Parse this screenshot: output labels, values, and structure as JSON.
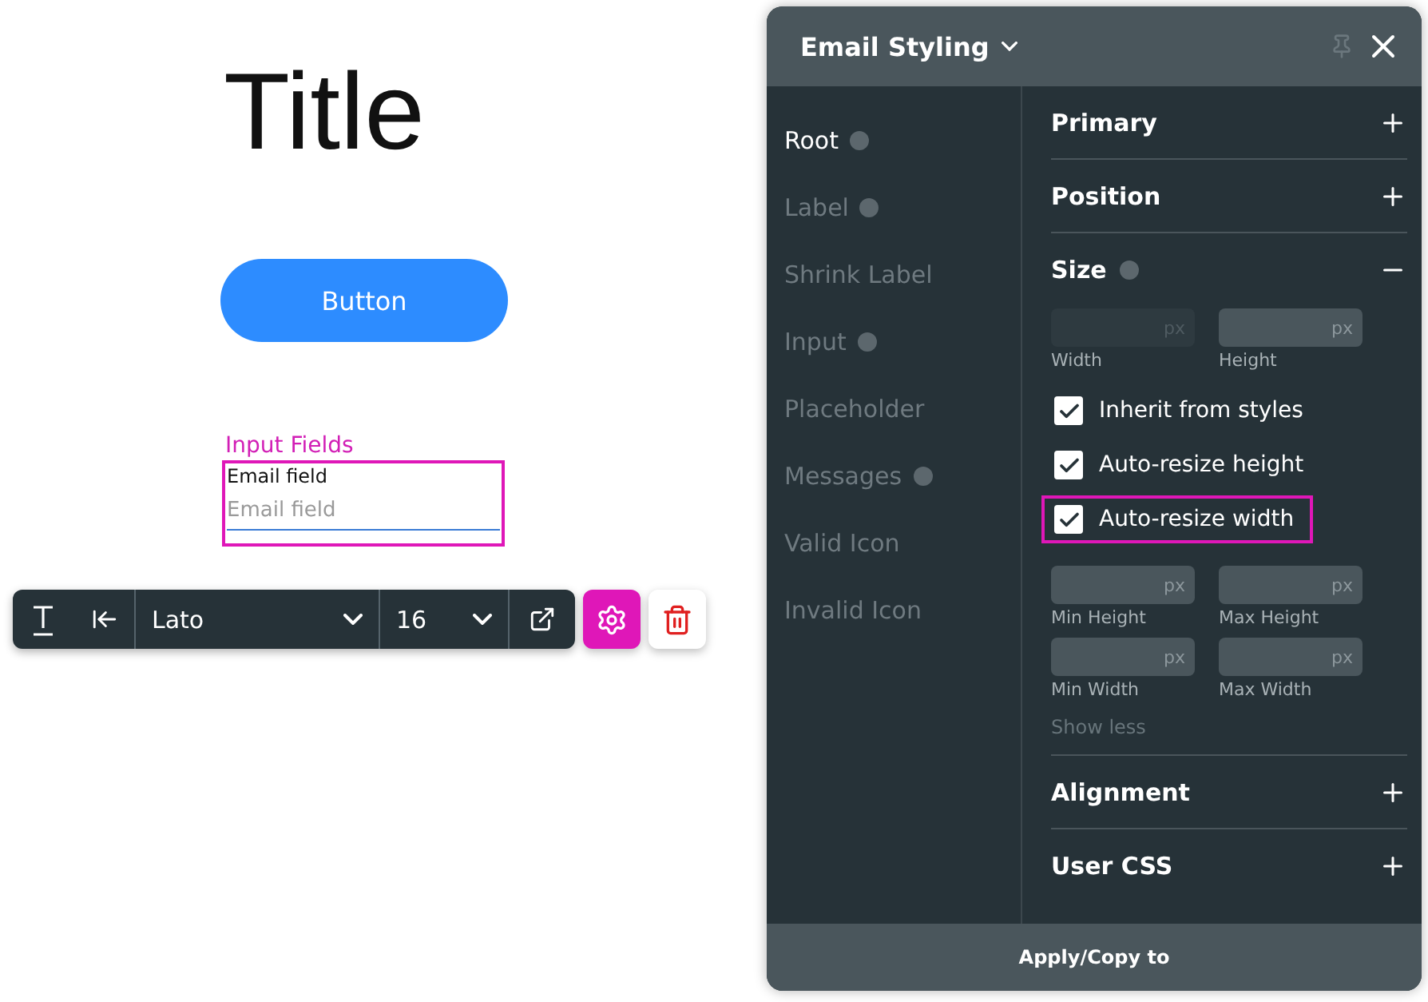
{
  "canvas": {
    "title": "Title",
    "button": "Button",
    "input_group": {
      "label": "Input Fields",
      "field_label": "Email field",
      "placeholder": "Email field",
      "highlighted": true
    }
  },
  "toolbar": {
    "font": "Lato",
    "size": "16"
  },
  "panel": {
    "title": "Email Styling",
    "parts": [
      {
        "label": "Root",
        "info": true,
        "selected": true
      },
      {
        "label": "Label",
        "info": true,
        "selected": false
      },
      {
        "label": "Shrink Label",
        "info": false,
        "selected": false
      },
      {
        "label": "Input",
        "info": true,
        "selected": false
      },
      {
        "label": "Placeholder",
        "info": false,
        "selected": false
      },
      {
        "label": "Messages",
        "info": true,
        "selected": false
      },
      {
        "label": "Valid Icon",
        "info": false,
        "selected": false
      },
      {
        "label": "Invalid Icon",
        "info": false,
        "selected": false
      }
    ],
    "sections": [
      {
        "label": "Primary",
        "info": false,
        "expanded": false
      },
      {
        "label": "Position",
        "info": false,
        "expanded": false
      },
      {
        "label": "Size",
        "info": true,
        "expanded": true
      },
      {
        "label": "Alignment",
        "info": false,
        "expanded": false
      },
      {
        "label": "User CSS",
        "info": false,
        "expanded": false
      }
    ],
    "size_fields": [
      {
        "label": "Width",
        "unit": "px",
        "disabled": true
      },
      {
        "label": "Height",
        "unit": "px",
        "disabled": false
      }
    ],
    "checkboxes": [
      {
        "label": "Inherit from styles",
        "checked": true,
        "highlighted": false
      },
      {
        "label": "Auto-resize height",
        "checked": true,
        "highlighted": false
      },
      {
        "label": "Auto-resize width",
        "checked": true,
        "highlighted": true
      }
    ],
    "limit_fields": [
      {
        "label": "Min Height",
        "unit": "px",
        "disabled": false
      },
      {
        "label": "Max Height",
        "unit": "px",
        "disabled": false
      },
      {
        "label": "Min Width",
        "unit": "px",
        "disabled": false
      },
      {
        "label": "Max Width",
        "unit": "px",
        "disabled": false
      }
    ],
    "show_less": "Show less",
    "footer": "Apply/Copy to"
  }
}
